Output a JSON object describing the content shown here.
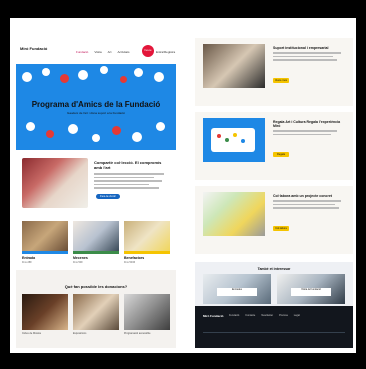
{
  "left_page": {
    "nav": {
      "logo": "Miró\nFundació",
      "items": [
        "Fundació",
        "Visita",
        "Art",
        "Activitats"
      ],
      "active_index": 0,
      "badge": "Fes-te\nAmic",
      "account": "Entra/Registra"
    },
    "hero": {
      "title": "Programa d'Amics de la Fundació",
      "subtitle": "Gaudeix de l'art i dóna suport a la Fundació",
      "colors": [
        "#1e88e5",
        "#ffffff",
        "#e53935"
      ]
    },
    "section1": {
      "title": "Compartir col·lecció. El compromís amb l'art",
      "button": "Fes-te Amic"
    },
    "cards": [
      {
        "title": "Entrada",
        "sub": "Fins 28€",
        "stripe": "#1e88e5"
      },
      {
        "title": "Mecenes",
        "sub": "Fins 50€",
        "stripe": "#3b8c49"
      },
      {
        "title": "Benefactors",
        "sub": "Fins 500€",
        "stripe": "#f5c400"
      }
    ],
    "band": {
      "title": "Què fan possible les donacions?",
      "captions": [
        "Cicles de Música",
        "Exposicions",
        "Programació accessible"
      ]
    }
  },
  "right_page": {
    "items": [
      {
        "title": "Suport institucional i empresarial",
        "button": "Veure més"
      },
      {
        "title": "Regala Art i Cultura\nRegala l'experiència Miró",
        "button": "Regala"
      },
      {
        "title": "Col·labora amb un projecte concret",
        "button": "Col·labora"
      }
    ],
    "section": {
      "title": "També et interessar",
      "overlay": [
        "Entrades",
        "Visita la Fundació"
      ]
    },
    "footer": {
      "logo": "Miró\nFundació",
      "cols": [
        "Fundació",
        "Contacte",
        "Newsletter",
        "Premsa",
        "Legal"
      ]
    }
  }
}
